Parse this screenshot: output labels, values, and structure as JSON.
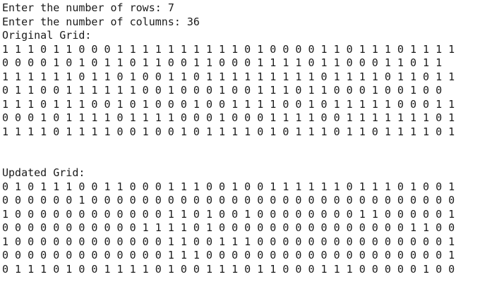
{
  "prompts": {
    "rows_label": "Enter the number of rows: ",
    "rows_value": "7",
    "cols_label": "Enter the number of columns: ",
    "cols_value": "36"
  },
  "original": {
    "header": "Original Grid:",
    "rows": [
      "1 1 1 0 1 1 0 0 0 1 1 1 1 1 1 1 1 1 1 0 1 0 0 0 0 1 1 0 1 1 1 0 1 1 1 1",
      "0 0 0 0 1 0 1 0 1 1 0 1 1 0 0 1 1 0 0 0 1 1 1 1 0 1 1 0 0 0 1 1 0 1 1",
      "1 1 1 1 1 1 0 1 1 0 1 0 0 1 1 0 1 1 1 1 1 1 1 1 1 0 1 1 1 1 0 1 1 0 1 1",
      "0 1 1 0 0 1 1 1 1 1 1 0 0 1 0 0 0 1 0 0 1 1 1 0 1 1 0 0 0 1 0 0 1 0 0",
      "1 1 1 0 1 1 1 0 0 1 0 1 0 0 0 1 0 0 1 1 1 1 0 0 1 0 1 1 1 1 1 0 0 0 1 1",
      "0 0 0 1 0 1 1 1 1 0 1 1 1 1 0 0 0 1 0 0 0 1 1 1 1 0 0 1 1 1 1 1 1 1 0 1",
      "1 1 1 1 0 1 1 1 1 0 0 1 0 0 1 0 1 1 1 1 0 1 0 1 1 1 0 1 1 0 1 1 1 1 0 1"
    ]
  },
  "updated": {
    "header": "Updated Grid:",
    "rows": [
      "0 1 0 1 1 1 0 0 1 1 0 0 0 1 1 1 0 0 1 0 0 1 1 1 1 1 1 0 1 1 1 0 1 0 0 1",
      "0 0 0 0 0 0 1 0 0 0 0 0 0 0 0 0 0 0 0 0 0 0 0 0 0 0 0 0 0 0 0 0 0 0 0 0",
      "1 0 0 0 0 0 0 0 0 0 0 0 0 1 1 0 1 0 0 1 0 0 0 0 0 0 0 0 1 1 0 0 0 0 0 1",
      "0 0 0 0 0 0 0 0 0 0 0 1 1 1 1 0 1 0 0 0 0 0 0 0 0 0 0 0 0 0 0 0 1 1 0 0",
      "1 0 0 0 0 0 0 0 0 0 0 0 0 1 1 0 0 1 1 1 0 0 0 0 0 0 0 0 0 0 0 0 0 0 0 1",
      "0 0 0 0 0 0 0 0 0 0 0 0 0 1 1 1 0 0 0 0 0 0 0 0 0 0 0 0 0 0 0 0 0 0 0 1",
      "0 1 1 1 0 1 0 0 1 1 1 1 0 1 0 0 1 1 1 0 1 1 0 0 0 1 1 1 0 0 0 0 0 1 0 0"
    ]
  }
}
